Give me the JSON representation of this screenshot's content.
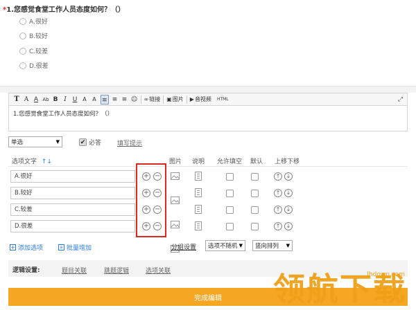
{
  "question": {
    "required_mark": "*",
    "title": "1.您感觉食堂工作人员态度如何？（）"
  },
  "preview_options": [
    "A.很好",
    "B.较好",
    "C.较差",
    "D.很差"
  ],
  "toolbar": {
    "items": [
      "T",
      "A",
      "A",
      "Ab",
      "B",
      "I",
      "U",
      "A",
      "A",
      "≡",
      "≡",
      "≡",
      "☺"
    ],
    "link_label": "链接",
    "image_label": "图片",
    "media_label": "音视频",
    "html_label": "HTML",
    "fullscreen_icon": "expand-icon"
  },
  "editor": {
    "content": "1.您感觉食堂工作人员态度如何？（）"
  },
  "settings": {
    "type_value": "单选",
    "required_label": "必答",
    "required_checked": true,
    "fill_hint_label": "填写提示"
  },
  "columns": {
    "option_text": "选项文字",
    "sort_icon": "↑↓",
    "image": "图片",
    "desc": "说明",
    "allow_fill": "允许填空",
    "default": "默认",
    "move": "上移下移"
  },
  "options": [
    {
      "label": "A.很好"
    },
    {
      "label": "B.较好"
    },
    {
      "label": "C.较差"
    },
    {
      "label": "D.很差"
    }
  ],
  "footer": {
    "add_option": "添加选项",
    "batch_add": "批量增加",
    "group_setting": "分组设置",
    "random_select": "选项不随机",
    "layout_select": "竖向排列"
  },
  "logic": {
    "label": "逻辑设置:",
    "title_link": "题目关联",
    "jump_logic": "跳题逻辑",
    "option_link": "选项关联"
  },
  "done_button": "完成编辑",
  "watermark": {
    "text": "领航下载",
    "url": "lhdown.com"
  },
  "colors": {
    "accent": "#f5a623",
    "required": "#e0271f",
    "highlight_box": "#e0271f",
    "link_blue": "#2b7ae0"
  }
}
